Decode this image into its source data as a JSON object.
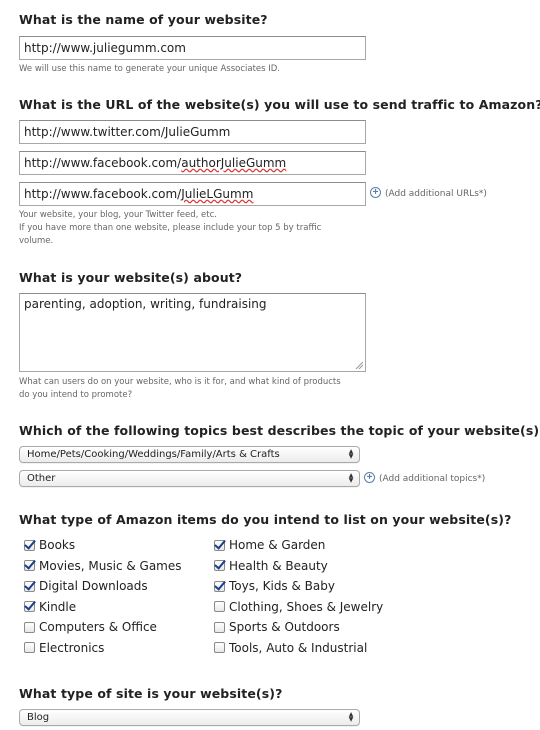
{
  "website_name": {
    "question": "What is the name of your website?",
    "value": "http://www.juliegumm.com",
    "hint": "We will use this name to generate your unique Associates ID."
  },
  "website_urls": {
    "question": "What is the URL of the website(s) you will use to send traffic to Amazon?",
    "urls": [
      {
        "prefix": "http://www.twitter.com/JulieGumm",
        "spell": "",
        "suffix": ""
      },
      {
        "prefix": "http://www.facebook.com/",
        "spell": "authorJulieGumm",
        "suffix": ""
      },
      {
        "prefix": "http://www.facebook.com/",
        "spell": "JulieLGumm",
        "suffix": ""
      }
    ],
    "add_label": "(Add additional URLs*)",
    "hint_line1": "Your website, your blog, your Twitter feed, etc.",
    "hint_line2": "If you have more than one website, please include your top 5 by traffic",
    "hint_line3": "volume."
  },
  "about": {
    "question": "What is your website(s) about?",
    "value": "parenting, adoption, writing, fundraising",
    "hint_line1": "What can users do on your website, who is it for, and what kind of products",
    "hint_line2": "do you intend to promote?"
  },
  "topics": {
    "question": "Which of the following topics best describes the topic of your website(s)?",
    "selects": [
      "Home/Pets/Cooking/Weddings/Family/Arts & Crafts",
      "Other"
    ],
    "add_label": "(Add additional topics*)"
  },
  "items": {
    "question": "What type of Amazon items do you intend to list on your website(s)?",
    "left": [
      {
        "label": "Books",
        "checked": true
      },
      {
        "label": "Movies, Music & Games",
        "checked": true
      },
      {
        "label": "Digital Downloads",
        "checked": true
      },
      {
        "label": "Kindle",
        "checked": true
      },
      {
        "label": "Computers & Office",
        "checked": false
      },
      {
        "label": "Electronics",
        "checked": false
      }
    ],
    "right": [
      {
        "label": "Home & Garden",
        "checked": true
      },
      {
        "label": "Health & Beauty",
        "checked": true
      },
      {
        "label": "Toys, Kids & Baby",
        "checked": true
      },
      {
        "label": "Clothing, Shoes & Jewelry",
        "checked": false
      },
      {
        "label": "Sports & Outdoors",
        "checked": false
      },
      {
        "label": "Tools, Auto & Industrial",
        "checked": false
      }
    ]
  },
  "site_type": {
    "question": "What type of site is your website(s)?",
    "value": "Blog"
  },
  "colors": {
    "check": "#1b3f8a",
    "plus": "#5b7fa8",
    "spell_underline": "#d33"
  },
  "icons": {
    "add": "plus-circle-icon",
    "checkmark": "checkmark-icon",
    "select_arrows": "updown-arrows-icon"
  }
}
